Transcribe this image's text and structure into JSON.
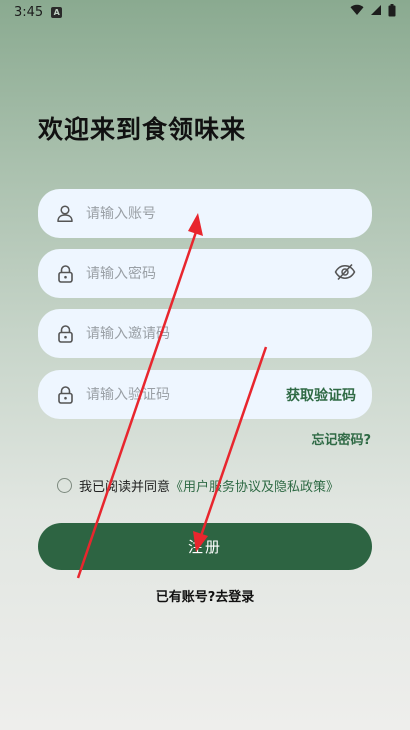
{
  "status_bar": {
    "time": "3:45",
    "badge": "A"
  },
  "page": {
    "title": "欢迎来到食领味来"
  },
  "form": {
    "account_placeholder": "请输入账号",
    "password_placeholder": "请输入密码",
    "invite_placeholder": "请输入邀请码",
    "code_placeholder": "请输入验证码",
    "get_code_label": "获取验证码",
    "forgot_label": "忘记密码?"
  },
  "agreement": {
    "prefix": "我已阅读并同意",
    "link": "《用户服务协议及隐私政策》",
    "checked": false
  },
  "register_button": "注册",
  "login": {
    "prompt": "已有账号?",
    "link": "去登录"
  },
  "icons": [
    "user-icon",
    "lock-icon",
    "eye-off-icon",
    "wifi-icon",
    "signal-icon",
    "battery-icon"
  ],
  "colors": {
    "accent": "#2d6442",
    "link": "#2f6a45",
    "field_bg": "#eef6ff",
    "annotation_arrow": "#e8262e"
  }
}
